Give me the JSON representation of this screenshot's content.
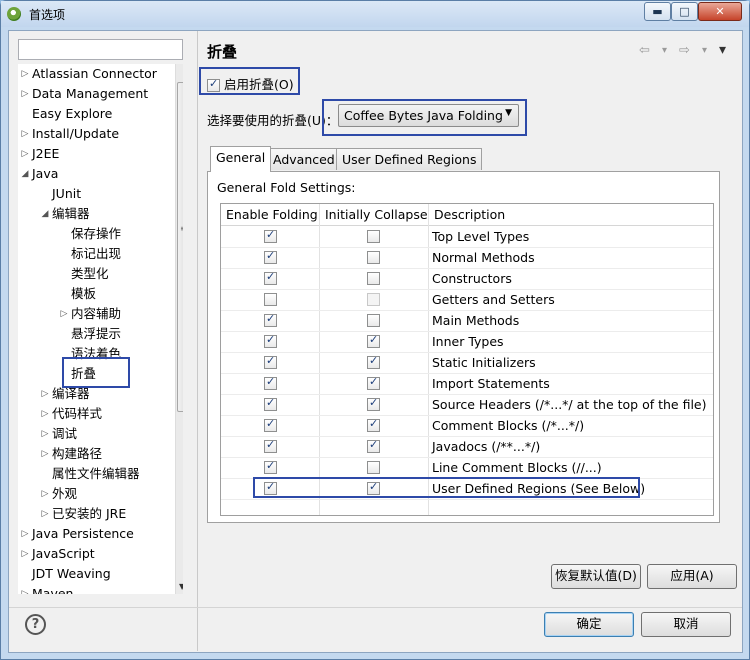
{
  "window": {
    "title": "首选项",
    "min": "▬",
    "max": "□",
    "close": "✕"
  },
  "filter": {
    "value": ""
  },
  "tree": [
    {
      "label": "Atlassian Connector",
      "arrow": "▷"
    },
    {
      "label": "Data Management",
      "arrow": "▷"
    },
    {
      "label": "Easy Explore",
      "arrow": ""
    },
    {
      "label": "Install/Update",
      "arrow": "▷"
    },
    {
      "label": "J2EE",
      "arrow": "▷"
    },
    {
      "label": "Java",
      "arrow": "◢"
    },
    {
      "label": "JUnit",
      "arrow": ""
    },
    {
      "label": "编辑器",
      "arrow": "◢"
    },
    {
      "label": "保存操作",
      "arrow": ""
    },
    {
      "label": "标记出现",
      "arrow": ""
    },
    {
      "label": "类型化",
      "arrow": ""
    },
    {
      "label": "模板",
      "arrow": ""
    },
    {
      "label": "内容辅助",
      "arrow": "▷"
    },
    {
      "label": "悬浮提示",
      "arrow": ""
    },
    {
      "label": "语法着色",
      "arrow": ""
    },
    {
      "label": "折叠",
      "arrow": ""
    },
    {
      "label": "编译器",
      "arrow": "▷"
    },
    {
      "label": "代码样式",
      "arrow": "▷"
    },
    {
      "label": "调试",
      "arrow": "▷"
    },
    {
      "label": "构建路径",
      "arrow": "▷"
    },
    {
      "label": "属性文件编辑器",
      "arrow": ""
    },
    {
      "label": "外观",
      "arrow": "▷"
    },
    {
      "label": "已安装的 JRE",
      "arrow": "▷"
    },
    {
      "label": "Java Persistence",
      "arrow": "▷"
    },
    {
      "label": "JavaScript",
      "arrow": "▷"
    },
    {
      "label": "JDT Weaving",
      "arrow": ""
    },
    {
      "label": "Maven",
      "arrow": "▷"
    }
  ],
  "page": {
    "title": "折叠",
    "nav": {
      "back": "⇦",
      "back_menu": "▾",
      "forward": "⇨",
      "forward_menu": "▾",
      "menu": "▾"
    },
    "enable_folding": {
      "label": "启用折叠(O)",
      "checked": true
    },
    "chooser_label": "选择要使用的折叠(U)：",
    "folding_select": "Coffee Bytes Java Folding",
    "tabs": [
      "General",
      "Advanced",
      "User Defined Regions"
    ],
    "section_label": "General Fold Settings:",
    "columns": [
      "Enable Folding",
      "Initially Collapse",
      "Description"
    ],
    "rows": [
      {
        "enable": true,
        "collapse": false,
        "collapse_enabled": true,
        "desc": "Top Level Types"
      },
      {
        "enable": true,
        "collapse": false,
        "collapse_enabled": true,
        "desc": "Normal Methods"
      },
      {
        "enable": true,
        "collapse": false,
        "collapse_enabled": true,
        "desc": "Constructors"
      },
      {
        "enable": false,
        "collapse": false,
        "collapse_enabled": false,
        "desc": "Getters and Setters"
      },
      {
        "enable": true,
        "collapse": false,
        "collapse_enabled": true,
        "desc": "Main Methods"
      },
      {
        "enable": true,
        "collapse": true,
        "collapse_enabled": true,
        "desc": "Inner Types"
      },
      {
        "enable": true,
        "collapse": true,
        "collapse_enabled": true,
        "desc": "Static Initializers"
      },
      {
        "enable": true,
        "collapse": true,
        "collapse_enabled": true,
        "desc": "Import Statements"
      },
      {
        "enable": true,
        "collapse": true,
        "collapse_enabled": true,
        "desc": "Source Headers (/*...*/ at the top of the file)"
      },
      {
        "enable": true,
        "collapse": true,
        "collapse_enabled": true,
        "desc": "Comment Blocks (/*...*/)"
      },
      {
        "enable": true,
        "collapse": true,
        "collapse_enabled": true,
        "desc": "Javadocs (/**...*/)"
      },
      {
        "enable": true,
        "collapse": false,
        "collapse_enabled": true,
        "desc": "Line Comment Blocks (//...)"
      },
      {
        "enable": true,
        "collapse": true,
        "collapse_enabled": true,
        "desc": "User Defined Regions (See Below)"
      }
    ],
    "restore_defaults": "恢复默认值(D)",
    "apply": "应用(A)"
  },
  "footer": {
    "help": "?",
    "ok": "确定",
    "cancel": "取消"
  },
  "colors": {
    "highlight": "#2e4aa8",
    "title_bar": "#c4d9ef"
  }
}
